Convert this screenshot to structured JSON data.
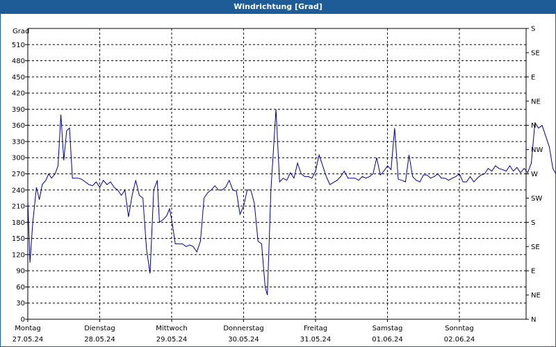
{
  "header": {
    "title": "Windrichtung [Grad]"
  },
  "colors": {
    "header": "#1d5c96",
    "series": "#00008b",
    "grid": "#000000"
  },
  "chart_data": {
    "type": "line",
    "title": "Windrichtung [Grad]",
    "ylabel": "Grad",
    "ylim": [
      0,
      540
    ],
    "y_ticks": [
      0,
      30,
      60,
      90,
      120,
      150,
      180,
      210,
      240,
      270,
      300,
      330,
      360,
      390,
      420,
      450,
      480,
      510
    ],
    "y2_ticks": [
      {
        "value": 0,
        "label": "N"
      },
      {
        "value": 45,
        "label": "NE"
      },
      {
        "value": 90,
        "label": "E"
      },
      {
        "value": 135,
        "label": "SE"
      },
      {
        "value": 180,
        "label": "S"
      },
      {
        "value": 225,
        "label": "SW"
      },
      {
        "value": 270,
        "label": "W"
      },
      {
        "value": 315,
        "label": "NW"
      },
      {
        "value": 360,
        "label": "N"
      },
      {
        "value": 405,
        "label": "NE"
      },
      {
        "value": 450,
        "label": "E"
      },
      {
        "value": 495,
        "label": "SE"
      },
      {
        "value": 540,
        "label": "S"
      }
    ],
    "xlim": [
      0,
      7
    ],
    "x_ticks": [
      {
        "day": "Montag",
        "date": "27.05.24"
      },
      {
        "day": "Dienstag",
        "date": "28.05.24"
      },
      {
        "day": "Mittwoch",
        "date": "29.05.24"
      },
      {
        "day": "Donnerstag",
        "date": "30.05.24"
      },
      {
        "day": "Freitag",
        "date": "31.05.24"
      },
      {
        "day": "Samstag",
        "date": "01.06.24"
      },
      {
        "day": "Sonntag",
        "date": "02.06.24"
      }
    ],
    "grid": true,
    "series": [
      {
        "values": [
          [
            0.0,
            220
          ],
          [
            0.03,
            105
          ],
          [
            0.07,
            180
          ],
          [
            0.12,
            245
          ],
          [
            0.16,
            222
          ],
          [
            0.2,
            250
          ],
          [
            0.25,
            258
          ],
          [
            0.29,
            270
          ],
          [
            0.33,
            262
          ],
          [
            0.38,
            270
          ],
          [
            0.42,
            285
          ],
          [
            0.46,
            380
          ],
          [
            0.5,
            295
          ],
          [
            0.54,
            350
          ],
          [
            0.58,
            355
          ],
          [
            0.62,
            262
          ],
          [
            0.7,
            262
          ],
          [
            0.75,
            260
          ],
          [
            0.8,
            255
          ],
          [
            0.85,
            250
          ],
          [
            0.9,
            248
          ],
          [
            0.95,
            255
          ],
          [
            1.0,
            245
          ],
          [
            1.05,
            258
          ],
          [
            1.1,
            250
          ],
          [
            1.15,
            255
          ],
          [
            1.2,
            245
          ],
          [
            1.25,
            240
          ],
          [
            1.3,
            230
          ],
          [
            1.35,
            240
          ],
          [
            1.4,
            190
          ],
          [
            1.45,
            230
          ],
          [
            1.5,
            258
          ],
          [
            1.55,
            230
          ],
          [
            1.6,
            225
          ],
          [
            1.65,
            130
          ],
          [
            1.7,
            85
          ],
          [
            1.75,
            240
          ],
          [
            1.8,
            258
          ],
          [
            1.83,
            180
          ],
          [
            1.88,
            185
          ],
          [
            1.93,
            192
          ],
          [
            1.97,
            205
          ],
          [
            2.0,
            185
          ],
          [
            2.05,
            140
          ],
          [
            2.15,
            140
          ],
          [
            2.2,
            135
          ],
          [
            2.25,
            138
          ],
          [
            2.3,
            135
          ],
          [
            2.35,
            125
          ],
          [
            2.4,
            145
          ],
          [
            2.45,
            225
          ],
          [
            2.5,
            235
          ],
          [
            2.55,
            240
          ],
          [
            2.6,
            248
          ],
          [
            2.65,
            240
          ],
          [
            2.7,
            240
          ],
          [
            2.75,
            245
          ],
          [
            2.8,
            258
          ],
          [
            2.85,
            240
          ],
          [
            2.9,
            238
          ],
          [
            2.95,
            195
          ],
          [
            3.0,
            210
          ],
          [
            3.05,
            240
          ],
          [
            3.1,
            240
          ],
          [
            3.15,
            215
          ],
          [
            3.2,
            145
          ],
          [
            3.25,
            140
          ],
          [
            3.3,
            60
          ],
          [
            3.33,
            45
          ],
          [
            3.38,
            240
          ],
          [
            3.45,
            390
          ],
          [
            3.5,
            255
          ],
          [
            3.55,
            262
          ],
          [
            3.6,
            258
          ],
          [
            3.65,
            272
          ],
          [
            3.7,
            262
          ],
          [
            3.75,
            290
          ],
          [
            3.8,
            270
          ],
          [
            3.85,
            265
          ],
          [
            3.9,
            265
          ],
          [
            3.95,
            262
          ],
          [
            4.0,
            275
          ],
          [
            4.05,
            305
          ],
          [
            4.1,
            285
          ],
          [
            4.15,
            265
          ],
          [
            4.2,
            250
          ],
          [
            4.3,
            258
          ],
          [
            4.35,
            265
          ],
          [
            4.4,
            275
          ],
          [
            4.45,
            262
          ],
          [
            4.55,
            262
          ],
          [
            4.6,
            258
          ],
          [
            4.65,
            265
          ],
          [
            4.7,
            262
          ],
          [
            4.75,
            265
          ],
          [
            4.8,
            270
          ],
          [
            4.85,
            300
          ],
          [
            4.9,
            268
          ],
          [
            4.95,
            275
          ],
          [
            5.0,
            285
          ],
          [
            5.05,
            278
          ],
          [
            5.1,
            355
          ],
          [
            5.15,
            260
          ],
          [
            5.2,
            258
          ],
          [
            5.25,
            255
          ],
          [
            5.3,
            305
          ],
          [
            5.35,
            265
          ],
          [
            5.4,
            258
          ],
          [
            5.45,
            255
          ],
          [
            5.5,
            268
          ],
          [
            5.55,
            268
          ],
          [
            5.6,
            262
          ],
          [
            5.65,
            265
          ],
          [
            5.7,
            270
          ],
          [
            5.75,
            262
          ],
          [
            5.8,
            262
          ],
          [
            5.85,
            258
          ],
          [
            5.9,
            262
          ],
          [
            5.95,
            265
          ],
          [
            6.0,
            270
          ],
          [
            6.05,
            255
          ],
          [
            6.1,
            255
          ],
          [
            6.15,
            265
          ],
          [
            6.2,
            255
          ],
          [
            6.25,
            262
          ],
          [
            6.3,
            268
          ],
          [
            6.35,
            270
          ],
          [
            6.4,
            280
          ],
          [
            6.45,
            275
          ],
          [
            6.5,
            285
          ],
          [
            6.55,
            280
          ],
          [
            6.6,
            278
          ],
          [
            6.65,
            275
          ],
          [
            6.7,
            285
          ],
          [
            6.75,
            275
          ],
          [
            6.8,
            282
          ],
          [
            6.85,
            272
          ],
          [
            6.9,
            280
          ],
          [
            6.95,
            272
          ],
          [
            7.0,
            290
          ],
          [
            7.05,
            365
          ],
          [
            7.1,
            355
          ],
          [
            7.15,
            360
          ],
          [
            7.2,
            340
          ],
          [
            7.25,
            320
          ],
          [
            7.3,
            280
          ],
          [
            7.35,
            268
          ],
          [
            7.4,
            245
          ],
          [
            7.45,
            245
          ],
          [
            7.5,
            278
          ]
        ]
      }
    ]
  }
}
